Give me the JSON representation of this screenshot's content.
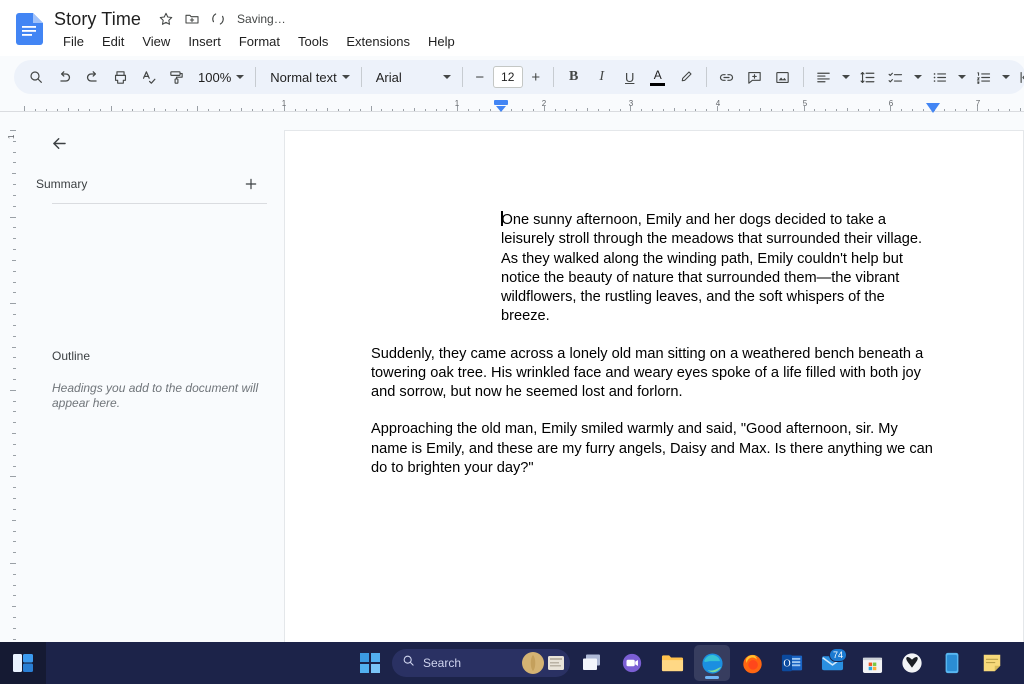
{
  "app": {
    "name": "Google Docs",
    "doc_icon": "google-docs-icon"
  },
  "header": {
    "title": "Story Time",
    "star_icon": "star-icon",
    "move_folder_icon": "move-to-folder-icon",
    "sync_icon": "sync-icon",
    "status": "Saving…",
    "menu": [
      {
        "label": "File"
      },
      {
        "label": "Edit"
      },
      {
        "label": "View"
      },
      {
        "label": "Insert"
      },
      {
        "label": "Format"
      },
      {
        "label": "Tools"
      },
      {
        "label": "Extensions"
      },
      {
        "label": "Help"
      }
    ]
  },
  "toolbar": {
    "search_icon": "search-icon",
    "undo_icon": "undo-icon",
    "redo_icon": "redo-icon",
    "print_icon": "print-icon",
    "spellcheck_icon": "spellcheck-icon",
    "paint_format_icon": "paint-format-icon",
    "zoom_value": "100%",
    "style_value": "Normal text",
    "font_value": "Arial",
    "font_size_decrease": "−",
    "font_size_value": "12",
    "font_size_increase": "+",
    "bold_label": "B",
    "italic_label": "I",
    "underline_label": "U",
    "text_color_label": "A",
    "text_color_swatch": "#000000",
    "highlight_icon": "highlighter-icon",
    "link_icon": "insert-link-icon",
    "comment_icon": "add-comment-icon",
    "image_icon": "insert-image-icon",
    "align_icon": "align-left-icon",
    "line_spacing_icon": "line-spacing-icon",
    "checklist_icon": "checklist-icon",
    "bulleted_list_icon": "bulleted-list-icon",
    "numbered_list_icon": "numbered-list-icon",
    "indent_icon": "decrease-indent-icon"
  },
  "ruler": {
    "horizontal_labels": [
      "1",
      "1",
      "2",
      "3",
      "4",
      "5",
      "6",
      "7"
    ],
    "vertical_labels": [
      "1"
    ],
    "left_indent_marker": "left-indent-marker",
    "right_indent_marker": "right-indent-marker",
    "marker_color": "#4285f4"
  },
  "sidebar": {
    "back_icon": "back-arrow-icon",
    "summary_label": "Summary",
    "add_summary_icon": "add-icon",
    "outline_label": "Outline",
    "outline_hint": "Headings you add to the document will appear here."
  },
  "document": {
    "paragraphs": [
      {
        "indented": true,
        "text": "One sunny afternoon, Emily and her dogs decided to take a leisurely stroll through the meadows that surrounded their village. As they walked along the winding path, Emily couldn't help but notice the beauty of nature that surrounded them—the vibrant wildflowers, the rustling leaves, and the soft whispers of the breeze."
      },
      {
        "indented": false,
        "text": "Suddenly, they came across a lonely old man sitting on a weathered bench beneath a towering oak tree. His wrinkled face and weary eyes spoke of a life filled with both joy and sorrow, but now he seemed lost and forlorn."
      },
      {
        "indented": false,
        "text": "Approaching the old man, Emily smiled warmly and said, \"Good afternoon, sir. My name is Emily, and these are my furry angels, Daisy and Max. Is there anything we can do to brighten your day?\""
      }
    ]
  },
  "taskbar": {
    "widgets_icon": "widgets-icon",
    "start_icon": "windows-start-icon",
    "search_icon": "search-icon",
    "search_placeholder": "Search",
    "task_view_icon": "task-view-icon",
    "items": [
      {
        "name": "teams-icon",
        "label": "Microsoft Teams"
      },
      {
        "name": "file-explorer-icon",
        "label": "File Explorer"
      },
      {
        "name": "edge-icon",
        "label": "Microsoft Edge",
        "active": true
      },
      {
        "name": "firefox-icon",
        "label": "Firefox"
      },
      {
        "name": "outlook-icon",
        "label": "Outlook"
      },
      {
        "name": "mail-icon",
        "label": "Mail",
        "badge": "74"
      },
      {
        "name": "microsoft-store-icon",
        "label": "Microsoft Store"
      },
      {
        "name": "xbox-icon",
        "label": "Xbox"
      },
      {
        "name": "phone-link-icon",
        "label": "Phone Link"
      },
      {
        "name": "sticky-notes-icon",
        "label": "Notes"
      }
    ]
  }
}
